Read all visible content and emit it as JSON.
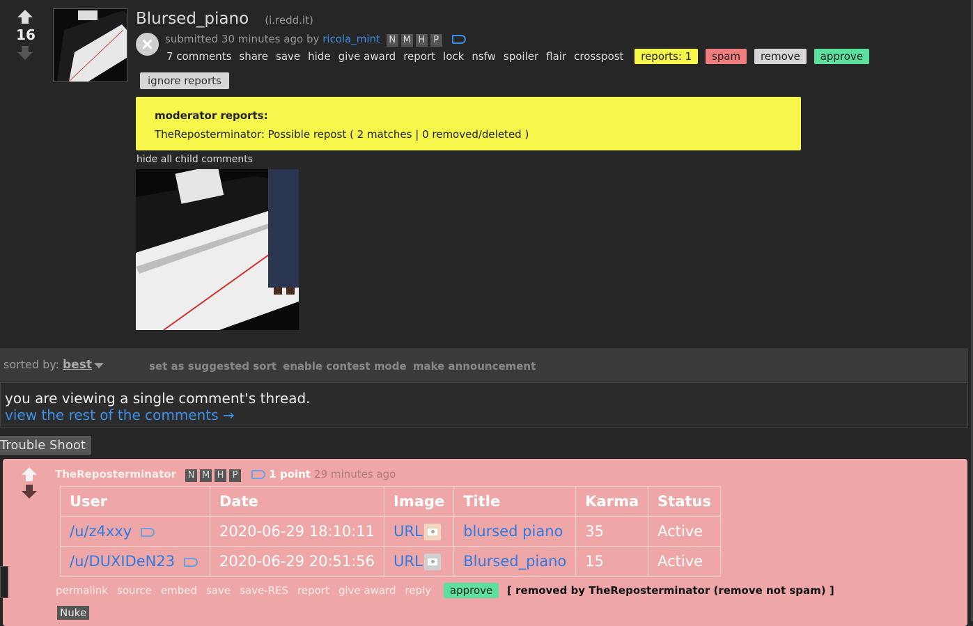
{
  "post": {
    "score": "16",
    "title": "Blursed_piano",
    "domain": "(i.redd.it)",
    "submitted_prefix": "submitted",
    "time": "30 minutes ago",
    "by_label": "by",
    "author": "ricola_mint",
    "flags": [
      "N",
      "M",
      "H",
      "P"
    ],
    "buttons": [
      "7 comments",
      "share",
      "save",
      "hide",
      "give award",
      "report",
      "lock",
      "nsfw",
      "spoiler",
      "flair",
      "crosspost"
    ],
    "reports_pill": "reports: 1",
    "spam": "spam",
    "remove": "remove",
    "approve": "approve",
    "ignore_reports": "ignore reports"
  },
  "reports": {
    "heading": "moderator reports:",
    "text": "TheReposterminator: Possible repost ( 2 matches | 0 removed/deleted )"
  },
  "hide_child": "hide all child comments",
  "sortbar": {
    "label": "sorted by:",
    "value": "best",
    "links": [
      "set as suggested sort",
      "enable contest mode",
      "make announcement"
    ]
  },
  "thread_notice": {
    "line1": "you are viewing a single comment's thread.",
    "line2": "view the rest of the comments →"
  },
  "trouble_tab": "Trouble Shoot",
  "comment": {
    "author": "TheReposterminator",
    "flags": [
      "N",
      "M",
      "H",
      "P"
    ],
    "points": "1 point",
    "time": "29 minutes ago",
    "table": {
      "headers": [
        "User",
        "Date",
        "Image",
        "Title",
        "Karma",
        "Status"
      ],
      "rows": [
        {
          "user": "/u/z4xxy",
          "date": "2020-06-29 18:10:11",
          "image": "URL",
          "title": "blursed piano",
          "karma": "35",
          "status": "Active"
        },
        {
          "user": "/u/DUXIDeN23",
          "date": "2020-06-29 20:51:56",
          "image": "URL",
          "title": "Blursed_piano",
          "karma": "15",
          "status": "Active"
        }
      ]
    },
    "buttons": [
      "permalink",
      "source",
      "embed",
      "save",
      "save-RES",
      "report",
      "give award",
      "reply"
    ],
    "approve": "approve",
    "removed_note": "[ removed by TheReposterminator (remove not spam) ]",
    "nuke": "Nuke"
  },
  "colors": {
    "background": "#262626",
    "link_blue": "#3d8fe8",
    "report_yellow": "#f6f64b",
    "spam_red": "#f07d7d",
    "approve_green": "#5de09e",
    "comment_pink": "#eea6a6"
  }
}
